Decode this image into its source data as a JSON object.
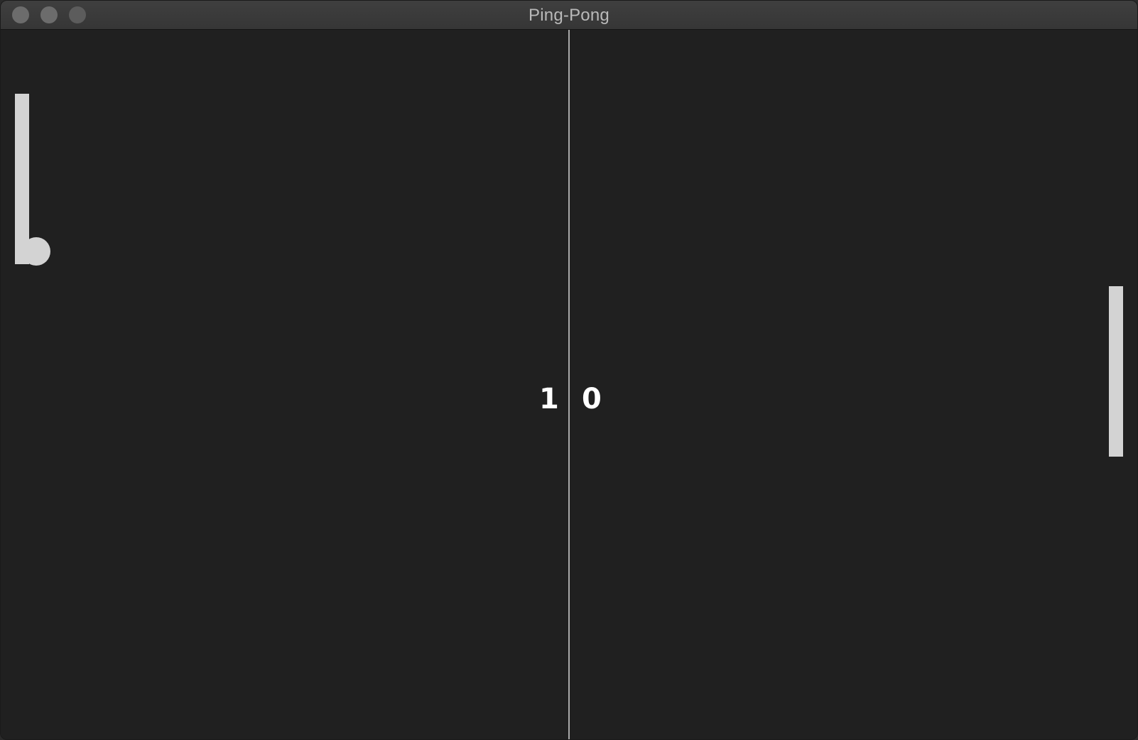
{
  "window": {
    "title": "Ping-Pong",
    "controls": [
      "close",
      "minimize",
      "zoom"
    ]
  },
  "game": {
    "score": {
      "left": "1",
      "right": "0"
    },
    "colors": {
      "background": "#202020",
      "paddle": "#d3d3d3",
      "ball": "#d3d3d3",
      "net": "#a8a8a8",
      "score": "#ffffff"
    }
  }
}
